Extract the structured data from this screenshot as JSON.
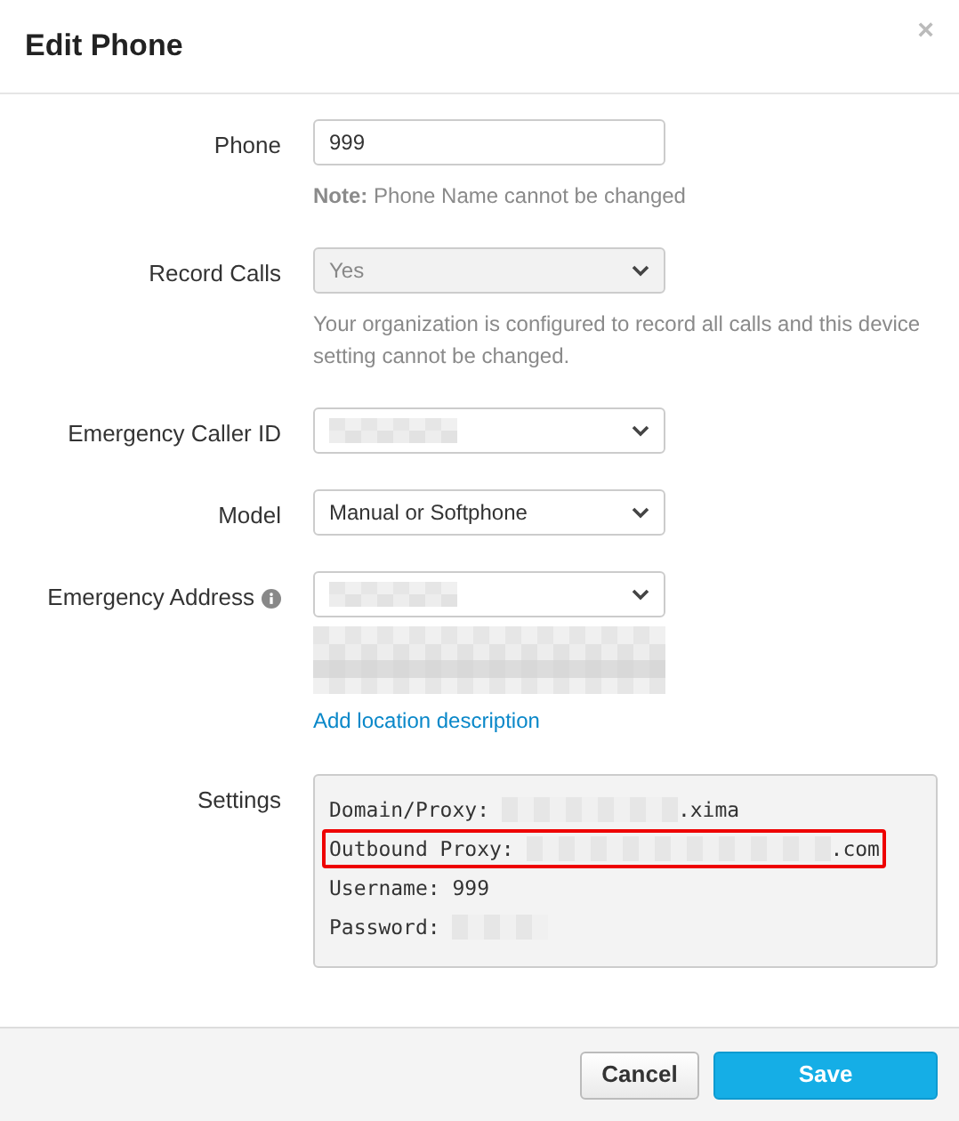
{
  "dialog": {
    "title": "Edit Phone",
    "close": "×"
  },
  "fields": [
    {
      "kind": "text",
      "label": "Phone",
      "value": "999",
      "note_bold": "Note:",
      "note": "Phone Name cannot be changed"
    },
    {
      "kind": "select",
      "label": "Record Calls",
      "value": "Yes",
      "disabled": true,
      "help": "Your organization is configured to record all calls and this device setting cannot be changed."
    },
    {
      "kind": "select",
      "label": "Emergency Caller ID",
      "redacted": true
    },
    {
      "kind": "select",
      "label": "Model",
      "value": "Manual or Softphone"
    },
    {
      "kind": "select",
      "label": "Emergency Address",
      "info": true,
      "redacted": true,
      "address_redacted": true,
      "link": "Add location description"
    }
  ],
  "settings": {
    "label": "Settings",
    "lines": [
      {
        "key": "Domain/Proxy:",
        "redacted": true,
        "suffix": ".xima",
        "highlighted": false
      },
      {
        "key": "Outbound Proxy:",
        "redacted": true,
        "suffix": ".com",
        "highlighted": true
      },
      {
        "key": "Username:",
        "value": "999",
        "highlighted": false
      },
      {
        "key": "Password:",
        "redacted": true,
        "highlighted": false
      }
    ]
  },
  "buttons": [
    {
      "kind": "secondary",
      "label": "Cancel"
    },
    {
      "kind": "primary",
      "label": "Save"
    }
  ]
}
